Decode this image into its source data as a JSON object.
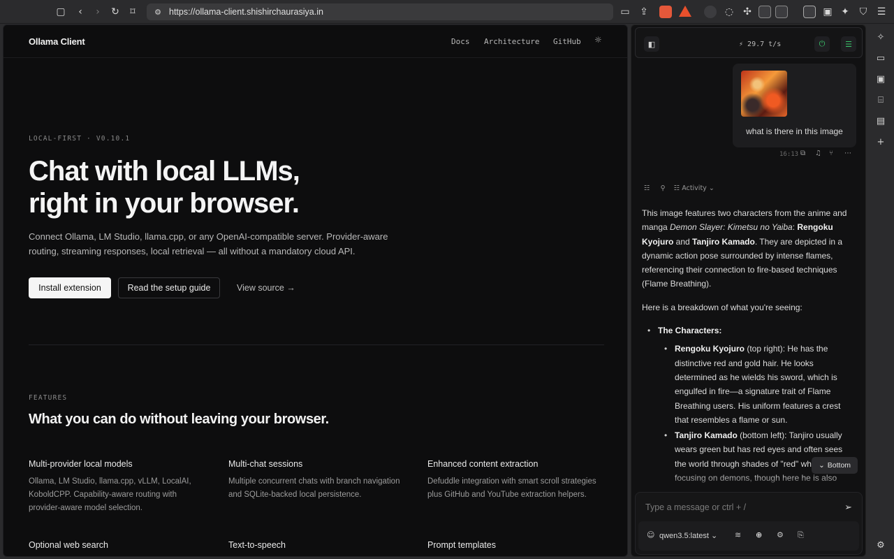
{
  "browser": {
    "url": "https://ollama-client.shishirchaurasiya.in"
  },
  "page": {
    "brand": "Ollama Client",
    "nav": [
      "Docs",
      "Architecture",
      "GitHub"
    ],
    "eyebrow": "LOCAL-FIRST · V0.10.1",
    "hero_title_line1": "Chat with local LLMs,",
    "hero_title_line2": "right in your browser.",
    "hero_sub": "Connect Ollama, LM Studio, llama.cpp, or any OpenAI-compatible server. Provider-aware routing, streaming responses, local retrieval — all without a mandatory cloud API.",
    "buttons": {
      "install": "Install extension",
      "guide": "Read the setup guide",
      "source": "View source →"
    },
    "features_eyebrow": "FEATURES",
    "features_title": "What you can do without leaving your browser.",
    "features": [
      {
        "title": "Multi-provider local models",
        "desc": "Ollama, LM Studio, llama.cpp, vLLM, LocalAI, KoboldCPP. Capability-aware routing with provider-aware model selection."
      },
      {
        "title": "Multi-chat sessions",
        "desc": "Multiple concurrent chats with branch navigation and SQLite-backed local persistence."
      },
      {
        "title": "Enhanced content extraction",
        "desc": "Defuddle integration with smart scroll strategies plus GitHub and YouTube extraction helpers."
      },
      {
        "title": "Optional web search",
        "desc": ""
      },
      {
        "title": "Text-to-speech",
        "desc": ""
      },
      {
        "title": "Prompt templates",
        "desc": ""
      }
    ]
  },
  "panel": {
    "speed": "29.7 t/s",
    "user_message": "what is there in this image",
    "msg_time": "16:13",
    "activity_label": "Activity",
    "answer": {
      "p1_a": "This image features two characters from the anime and manga ",
      "p1_title": "Demon Slayer: Kimetsu no Yaiba",
      "p1_b": ": ",
      "p1_name1": "Rengoku Kyojuro",
      "p1_and": " and ",
      "p1_name2": "Tanjiro Kamado",
      "p1_c": ". They are depicted in a dynamic action pose surrounded by intense flames, referencing their connection to fire-based techniques (Flame Breathing).",
      "p2": "Here is a breakdown of what you're seeing:",
      "b1": "The Characters:",
      "b1a_name": "Rengoku Kyojuro",
      "b1a_text": " (top right): He has the distinctive red and gold hair. He looks determined as he wields his sword, which is engulfed in fire—a signature trait of Flame Breathing users. His uniform features a crest that resembles a flame or sun.",
      "b1b_name": "Tanjiro Kamado",
      "b1b_text": " (bottom left): Tanjiro usually wears green but has red eyes and often sees the world through shades of \"red\" when focusing on demons, though here he is also"
    },
    "scroll_bottom": "Bottom",
    "composer_placeholder": "Type a message or ctrl + /",
    "model": "qwen3.5:latest"
  }
}
